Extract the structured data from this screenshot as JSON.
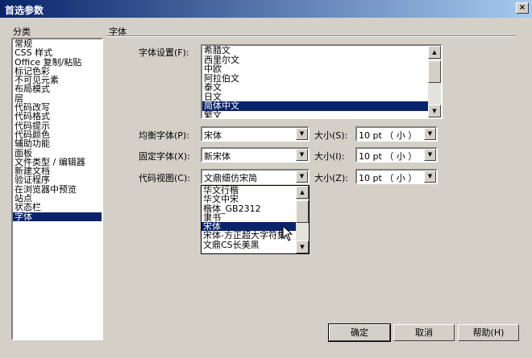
{
  "window": {
    "title": "首选参数",
    "close_glyph": "×"
  },
  "categories": {
    "header": "分类",
    "items": [
      "常规",
      "CSS 样式",
      "Office 复制/粘贴",
      "标记色彩",
      "不可见元素",
      "布局模式",
      "层",
      "代码改写",
      "代码格式",
      "代码提示",
      "代码颜色",
      "辅助功能",
      "面板",
      "文件类型 / 编辑器",
      "新建文档",
      "验证程序",
      "在浏览器中预览",
      "站点",
      "状态栏",
      "字体"
    ],
    "selected": "字体"
  },
  "section": {
    "title": "字体"
  },
  "font_settings": {
    "label": "字体设置(F):",
    "items": [
      "希腊文",
      "西里尔文",
      "中欧",
      "阿拉伯文",
      "泰文",
      "日文",
      "简体中文",
      "繁文"
    ],
    "selected": "简体中文"
  },
  "proportional": {
    "label": "均衡字体(P):",
    "value": "宋体",
    "size_label": "大小(S):",
    "size_value": "10 pt （ 小 ）"
  },
  "fixed": {
    "label": "固定字体(X):",
    "value": "新宋体",
    "size_label": "大小(I):",
    "size_value": "10 pt （ 小 ）"
  },
  "code_view": {
    "label": "代码视图(C):",
    "value": "文鼎细仿宋简",
    "size_label": "大小(Z):",
    "size_value": "10 pt （ 小 ）",
    "dropdown_items": [
      "华文行楷",
      "华文中宋",
      "楷体_GB2312",
      "隶书",
      "宋体",
      "宋体-方正超大字符集",
      "文鼎CS长美黑"
    ],
    "dropdown_selected": "宋体"
  },
  "buttons": {
    "ok": "确定",
    "cancel": "取消",
    "help": "帮助(H)"
  },
  "icons": {
    "scroll_up": "up-arrow-icon",
    "scroll_down": "down-arrow-icon",
    "dropdown": "dropdown-arrow-icon",
    "cursor": "mouse-pointer-icon",
    "up_glyph": "▲",
    "down_glyph": "▼"
  },
  "colors": {
    "titlebar_start": "#0a246a",
    "titlebar_end": "#a6caf0",
    "selection": "#0a246a",
    "dialog_bg": "#d4d0c8"
  }
}
